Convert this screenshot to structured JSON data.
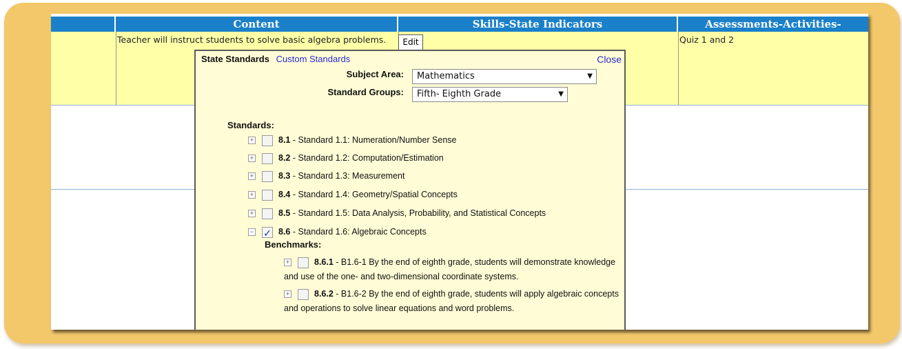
{
  "headers": [
    "",
    "Content",
    "Skills-State Indicators",
    "Assessments-Activities-"
  ],
  "row1": {
    "content": "Teacher will instruct students to solve basic algebra problems.",
    "skills_tab": "Edit",
    "assessments": "Quiz 1 and 2"
  },
  "popup": {
    "tab_active": "State Standards",
    "tab_other": "Custom Standards",
    "close": "Close",
    "subject_label": "Subject Area:",
    "subject_value": "Mathematics",
    "groups_label": "Standard Groups:",
    "groups_value": "Fifth- Eighth Grade",
    "standards_heading": "Standards:",
    "standards": [
      {
        "code": "8.1",
        "text": " - Standard 1.1: Numeration/Number Sense",
        "checked": false,
        "expanded": false
      },
      {
        "code": "8.2",
        "text": " - Standard 1.2: Computation/Estimation",
        "checked": false,
        "expanded": false
      },
      {
        "code": "8.3",
        "text": " - Standard 1.3: Measurement",
        "checked": false,
        "expanded": false
      },
      {
        "code": "8.4",
        "text": " - Standard 1.4: Geometry/Spatial Concepts",
        "checked": false,
        "expanded": false
      },
      {
        "code": "8.5",
        "text": " - Standard 1.5: Data Analysis, Probability, and Statistical Concepts",
        "checked": false,
        "expanded": false
      },
      {
        "code": "8.6",
        "text": " - Standard 1.6: Algebraic Concepts",
        "checked": true,
        "expanded": true
      }
    ],
    "benchmarks_heading": "Benchmarks:",
    "benchmarks": [
      {
        "code": "8.6.1",
        "text": " - B1.6-1 By the end of eighth grade, students will demonstrate knowledge and use of the one- and two-dimensional coordinate systems."
      },
      {
        "code": "8.6.2",
        "text": " - B1.6-2 By the end of eighth grade, students will apply algebraic concepts and operations to solve linear equations and word problems."
      }
    ]
  },
  "colors": {
    "header_blue": "#1a80c9",
    "row_yellow": "#ffffa8",
    "frame_gold": "#f3c86a",
    "link_blue": "#2a2ad0"
  }
}
